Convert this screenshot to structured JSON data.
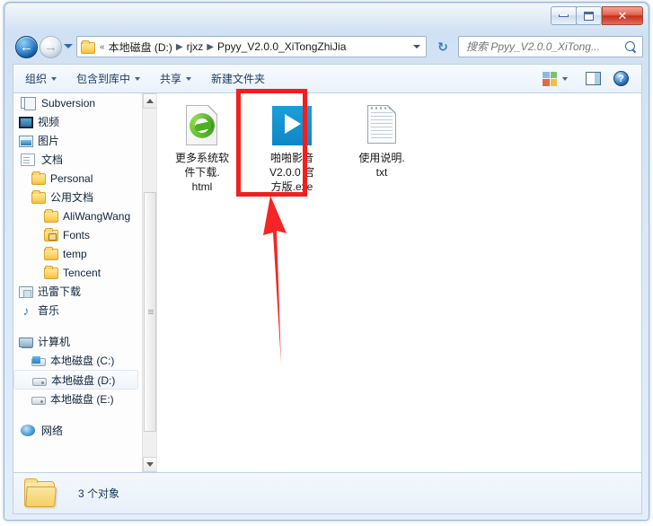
{
  "window": {
    "title": "",
    "buttons": {
      "minimize": "minimize",
      "maximize": "maximize",
      "close": "✕"
    }
  },
  "addressbar": {
    "back_glyph": "←",
    "forward_glyph": "→",
    "root_sep": "«",
    "crumbs": [
      "本地磁盘 (D:)",
      "rjxz",
      "Ppyy_V2.0.0_XiTongZhiJia"
    ],
    "separator": "▶",
    "refresh_glyph": "↻"
  },
  "search": {
    "placeholder": "搜索 Ppyy_V2.0.0_XiTong...",
    "value": ""
  },
  "toolbar": {
    "organize": "组织",
    "include_in_library": "包含到库中",
    "share": "共享",
    "new_folder": "新建文件夹",
    "view_label": "change-view",
    "preview_label": "preview-pane",
    "help_label": "?"
  },
  "sidebar": {
    "items": [
      {
        "label": "Subversion",
        "icon": "svn-icon",
        "indent": 0,
        "selected": false
      },
      {
        "label": "视频",
        "icon": "video-icon",
        "indent": 0,
        "selected": false
      },
      {
        "label": "图片",
        "icon": "picture-icon",
        "indent": 0,
        "selected": false
      },
      {
        "label": "文档",
        "icon": "document-icon",
        "indent": 0,
        "selected": false
      },
      {
        "label": "Personal",
        "icon": "folder-icon",
        "indent": 1,
        "selected": false
      },
      {
        "label": "公用文档",
        "icon": "folder-icon",
        "indent": 1,
        "selected": false
      },
      {
        "label": "AliWangWang",
        "icon": "folder-icon",
        "indent": 2,
        "selected": false
      },
      {
        "label": "Fonts",
        "icon": "folder-lock-icon",
        "indent": 2,
        "selected": false
      },
      {
        "label": "temp",
        "icon": "folder-icon",
        "indent": 2,
        "selected": false
      },
      {
        "label": "Tencent",
        "icon": "folder-icon",
        "indent": 2,
        "selected": false
      },
      {
        "label": "迅雷下载",
        "icon": "download-icon",
        "indent": 0,
        "selected": false
      },
      {
        "label": "音乐",
        "icon": "music-icon",
        "indent": 0,
        "selected": false
      },
      {
        "label": "",
        "icon": "spacer",
        "indent": 0,
        "selected": false
      },
      {
        "label": "计算机",
        "icon": "computer-icon",
        "indent": 0,
        "selected": false
      },
      {
        "label": "本地磁盘 (C:)",
        "icon": "drive-system-icon",
        "indent": 1,
        "selected": false
      },
      {
        "label": "本地磁盘 (D:)",
        "icon": "drive-icon",
        "indent": 1,
        "selected": true
      },
      {
        "label": "本地磁盘 (E:)",
        "icon": "drive-icon",
        "indent": 1,
        "selected": false
      },
      {
        "label": "",
        "icon": "spacer",
        "indent": 0,
        "selected": false
      },
      {
        "label": "网络",
        "icon": "network-icon",
        "indent": 0,
        "selected": false
      }
    ]
  },
  "files": [
    {
      "name": "更多系统软件下载.html",
      "lines": [
        "更多系统软",
        "件下载.",
        "html"
      ],
      "icon": "html-file-icon",
      "highlighted": false
    },
    {
      "name": "啪啪影音V2.0.0 官方版.exe",
      "lines": [
        "啪啪影音",
        "V2.0.0 官",
        "方版.exe"
      ],
      "icon": "exe-play-icon",
      "highlighted": true
    },
    {
      "name": "使用说明.txt",
      "lines": [
        "使用说明.",
        "txt"
      ],
      "icon": "txt-file-icon",
      "highlighted": false
    }
  ],
  "annotations": {
    "highlight_color": "#f41e1e",
    "arrow_color": "#f42525",
    "arrow_target": "啪啪影音V2.0.0 官方版.exe"
  },
  "statusbar": {
    "item_count_text": "3 个对象"
  }
}
